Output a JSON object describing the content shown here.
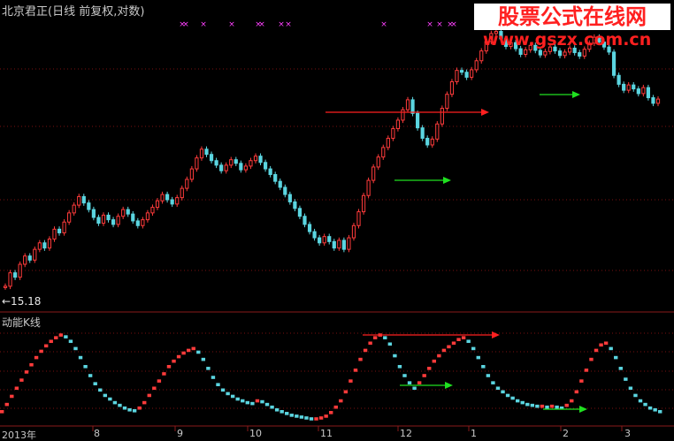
{
  "title": "北京君正(日线 前复权,对数)",
  "indicator_title": "动能K线",
  "low_marker": "←15.18",
  "watermark": {
    "line1": "股票公式在线网",
    "line2": "www.gszx.com.cn"
  },
  "x_axis_labels": [
    "2013年",
    "8",
    "9",
    "10",
    "11",
    "12",
    "1",
    "2",
    "3"
  ],
  "colors": {
    "up": "#ff3b3b",
    "down": "#5bd5e0",
    "red_arrow": "#ff2020",
    "green_arrow": "#20e020",
    "marker": "#ff40ff",
    "grid": "#7a1010"
  },
  "chart_data": [
    {
      "type": "candlestick",
      "title": "北京君正(日线 前复权,对数)",
      "scale": "log",
      "annotation_low": "←15.18",
      "x_ticks": [
        "2013年",
        "8",
        "9",
        "10",
        "11",
        "12",
        "1",
        "2",
        "3"
      ],
      "close": [
        15.3,
        16.2,
        15.9,
        16.8,
        17.4,
        17.1,
        17.9,
        18.4,
        18.0,
        18.7,
        19.5,
        19.2,
        20.1,
        20.9,
        21.6,
        22.4,
        21.8,
        21.2,
        20.5,
        20.0,
        20.7,
        20.3,
        19.9,
        20.6,
        21.2,
        20.8,
        20.2,
        19.8,
        20.3,
        20.9,
        21.4,
        22.0,
        22.6,
        22.1,
        21.7,
        22.3,
        23.2,
        24.1,
        25.2,
        26.4,
        27.4,
        26.8,
        26.1,
        25.6,
        25.0,
        25.6,
        26.2,
        25.8,
        25.1,
        25.5,
        26.1,
        26.6,
        25.9,
        25.2,
        24.6,
        23.9,
        23.3,
        22.6,
        21.9,
        21.3,
        20.6,
        19.9,
        19.3,
        18.8,
        18.4,
        18.9,
        18.5,
        18.0,
        18.6,
        17.9,
        18.8,
        19.8,
        21.0,
        22.5,
        24.0,
        25.4,
        26.5,
        27.6,
        28.7,
        29.9,
        31.0,
        32.4,
        33.8,
        31.9,
        30.0,
        28.7,
        27.9,
        28.6,
        30.5,
        32.6,
        34.6,
        36.5,
        38.3,
        38.0,
        37.2,
        38.4,
        39.9,
        41.6,
        43.3,
        44.8,
        45.2,
        43.8,
        42.4,
        43.1,
        42.0,
        41.0,
        41.8,
        42.6,
        41.7,
        40.9,
        41.5,
        42.3,
        41.6,
        40.8,
        41.4,
        42.1,
        41.3,
        40.7,
        41.9,
        43.0,
        44.1,
        43.2,
        42.3,
        41.4,
        37.5,
        36.1,
        35.2,
        36.0,
        35.4,
        34.7,
        35.6,
        34.1,
        33.3,
        33.9
      ],
      "markers_row": "xx",
      "arrows": [
        {
          "color": "red",
          "panel": "price",
          "direction": "right"
        },
        {
          "color": "green",
          "panel": "price",
          "direction": "right"
        },
        {
          "color": "green",
          "panel": "price",
          "direction": "right"
        }
      ]
    },
    {
      "type": "line",
      "title": "动能K线",
      "values": [
        10,
        18,
        27,
        36,
        45,
        54,
        62,
        70,
        77,
        83,
        88,
        92,
        95,
        93,
        88,
        80,
        70,
        60,
        50,
        41,
        34,
        28,
        24,
        20,
        17,
        14,
        12,
        11,
        14,
        20,
        28,
        36,
        44,
        52,
        60,
        66,
        71,
        75,
        78,
        80,
        76,
        68,
        58,
        48,
        40,
        34,
        30,
        27,
        24,
        22,
        20,
        19,
        22,
        21,
        18,
        15,
        12,
        10,
        8,
        6,
        5,
        4,
        3,
        2,
        2,
        3,
        5,
        9,
        15,
        22,
        32,
        44,
        56,
        68,
        78,
        86,
        92,
        95,
        92,
        85,
        72,
        60,
        50,
        42,
        36,
        42,
        50,
        58,
        66,
        72,
        78,
        82,
        86,
        90,
        92,
        88,
        80,
        70,
        60,
        50,
        42,
        36,
        32,
        28,
        25,
        22,
        20,
        18,
        17,
        16,
        16,
        15,
        16,
        15,
        14,
        17,
        22,
        32,
        44,
        56,
        68,
        78,
        84,
        86,
        80,
        70,
        58,
        46,
        36,
        28,
        22,
        18,
        14,
        12,
        10
      ]
    }
  ]
}
